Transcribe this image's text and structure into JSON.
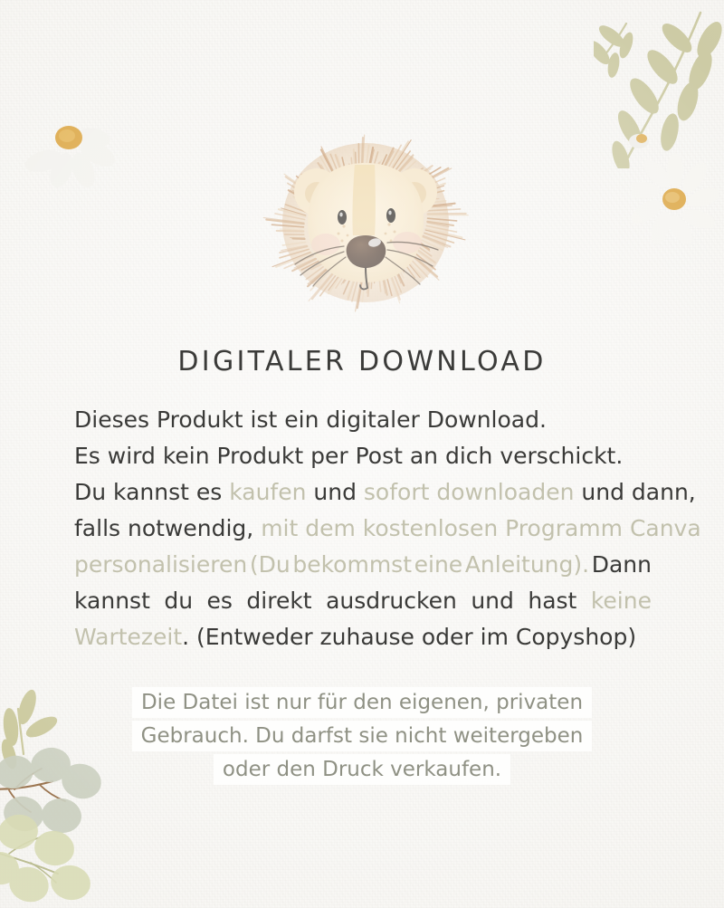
{
  "page": {
    "background_color": "#f7f6f3",
    "text_color_dark": "#3a3a38",
    "text_color_muted": "#c2c1ad",
    "notice_text_color": "#8f9184",
    "highlight_color": "#fefefd"
  },
  "artwork": {
    "lion": {
      "name": "watercolor-lion-head",
      "mane_color": "#c9996c",
      "mane_light_color": "#e7cfae",
      "face_color": "#f6e7cd",
      "face_stripe_color": "#eed9ae",
      "nose_color": "#4a3526",
      "cheek_color": "#eec9bd"
    },
    "botanical_top_right": {
      "name": "olive-branch-sprig",
      "color": "#cdcba5"
    },
    "botanical_bottom_left": {
      "name": "eucalyptus-sprig",
      "leaf_color": "#cbd0c0",
      "leaf_color_warm": "#d9dcb4",
      "stem_color": "#9b7550",
      "olive_leaf_color": "#ccca9f"
    },
    "daisy_left": {
      "name": "daisy-flower",
      "petal_color": "#f3f2ee",
      "center_color": "#dda94a"
    },
    "daisy_right": {
      "name": "daisy-flower",
      "petal_color": "#f6f5f1",
      "center_color": "#dda94a"
    }
  },
  "title": "DIGITALER DOWNLOAD",
  "body": {
    "lines": [
      {
        "id": "line-1",
        "justify": false,
        "parts": [
          {
            "text": "Dieses Produkt ist ein digitaler Download.",
            "muted": false
          }
        ]
      },
      {
        "id": "line-2",
        "justify": false,
        "parts": [
          {
            "text": "Es wird kein Produkt per Post an dich verschickt.",
            "muted": false
          }
        ]
      },
      {
        "id": "line-3",
        "justify": false,
        "parts": [
          {
            "text": "Du kannst es ",
            "muted": false
          },
          {
            "text": "kaufen",
            "muted": true
          },
          {
            "text": " und ",
            "muted": false
          },
          {
            "text": "sofort downloaden",
            "muted": true
          },
          {
            "text": " und dann,",
            "muted": false
          }
        ]
      },
      {
        "id": "line-4",
        "justify": false,
        "parts": [
          {
            "text": "falls notwendig, ",
            "muted": false
          },
          {
            "text": "mit dem kostenlosen Programm Canva",
            "muted": true
          }
        ]
      },
      {
        "id": "line-5",
        "justify": true,
        "parts": [
          {
            "text": "personalisieren",
            "muted": true
          },
          {
            "text": "(Du",
            "muted": true
          },
          {
            "text": "bekommst",
            "muted": true
          },
          {
            "text": "eine",
            "muted": true
          },
          {
            "text": "Anleitung).",
            "muted": true
          },
          {
            "text": "Dann",
            "muted": false
          }
        ]
      },
      {
        "id": "line-6",
        "justify": true,
        "parts": [
          {
            "text": "kannst",
            "muted": false
          },
          {
            "text": "du",
            "muted": false
          },
          {
            "text": "es",
            "muted": false
          },
          {
            "text": "direkt",
            "muted": false
          },
          {
            "text": "ausdrucken",
            "muted": false
          },
          {
            "text": "und",
            "muted": false
          },
          {
            "text": "hast",
            "muted": false
          },
          {
            "text": "keine",
            "muted": true
          }
        ]
      },
      {
        "id": "line-7",
        "justify": false,
        "parts": [
          {
            "text": "Wartezeit",
            "muted": true
          },
          {
            "text": ". (Entweder zuhause oder im Copyshop)",
            "muted": false
          }
        ]
      }
    ]
  },
  "notice": {
    "lines": [
      "Die Datei ist nur für den eigenen, privaten",
      "Gebrauch. Du darfst sie nicht weitergeben",
      "oder den Druck verkaufen."
    ]
  }
}
